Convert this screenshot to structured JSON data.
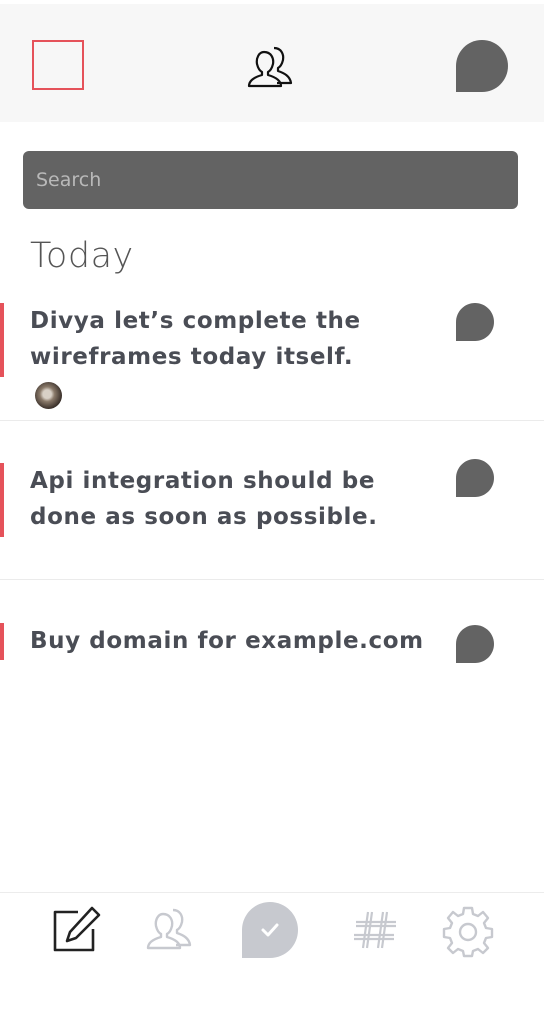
{
  "search": {
    "placeholder": "Search"
  },
  "section": {
    "title": "Today"
  },
  "tasks": [
    {
      "text": "Divya let’s complete the wireframes today itself."
    },
    {
      "text": "Api integration should be done as soon as possible."
    },
    {
      "text": "Buy domain for example.com"
    }
  ],
  "colors": {
    "accent": "#e5525a",
    "dark_gray": "#636363",
    "text": "#4a4d55",
    "icon_light": "#c7c9cf"
  },
  "icons": {
    "header_left": "square-checkbox-icon",
    "header_center": "people-icon",
    "header_right": "chat-bubble-icon",
    "nav": [
      "compose-icon",
      "people-icon",
      "check-circle-icon",
      "hashtag-icon",
      "settings-gear-icon"
    ]
  }
}
